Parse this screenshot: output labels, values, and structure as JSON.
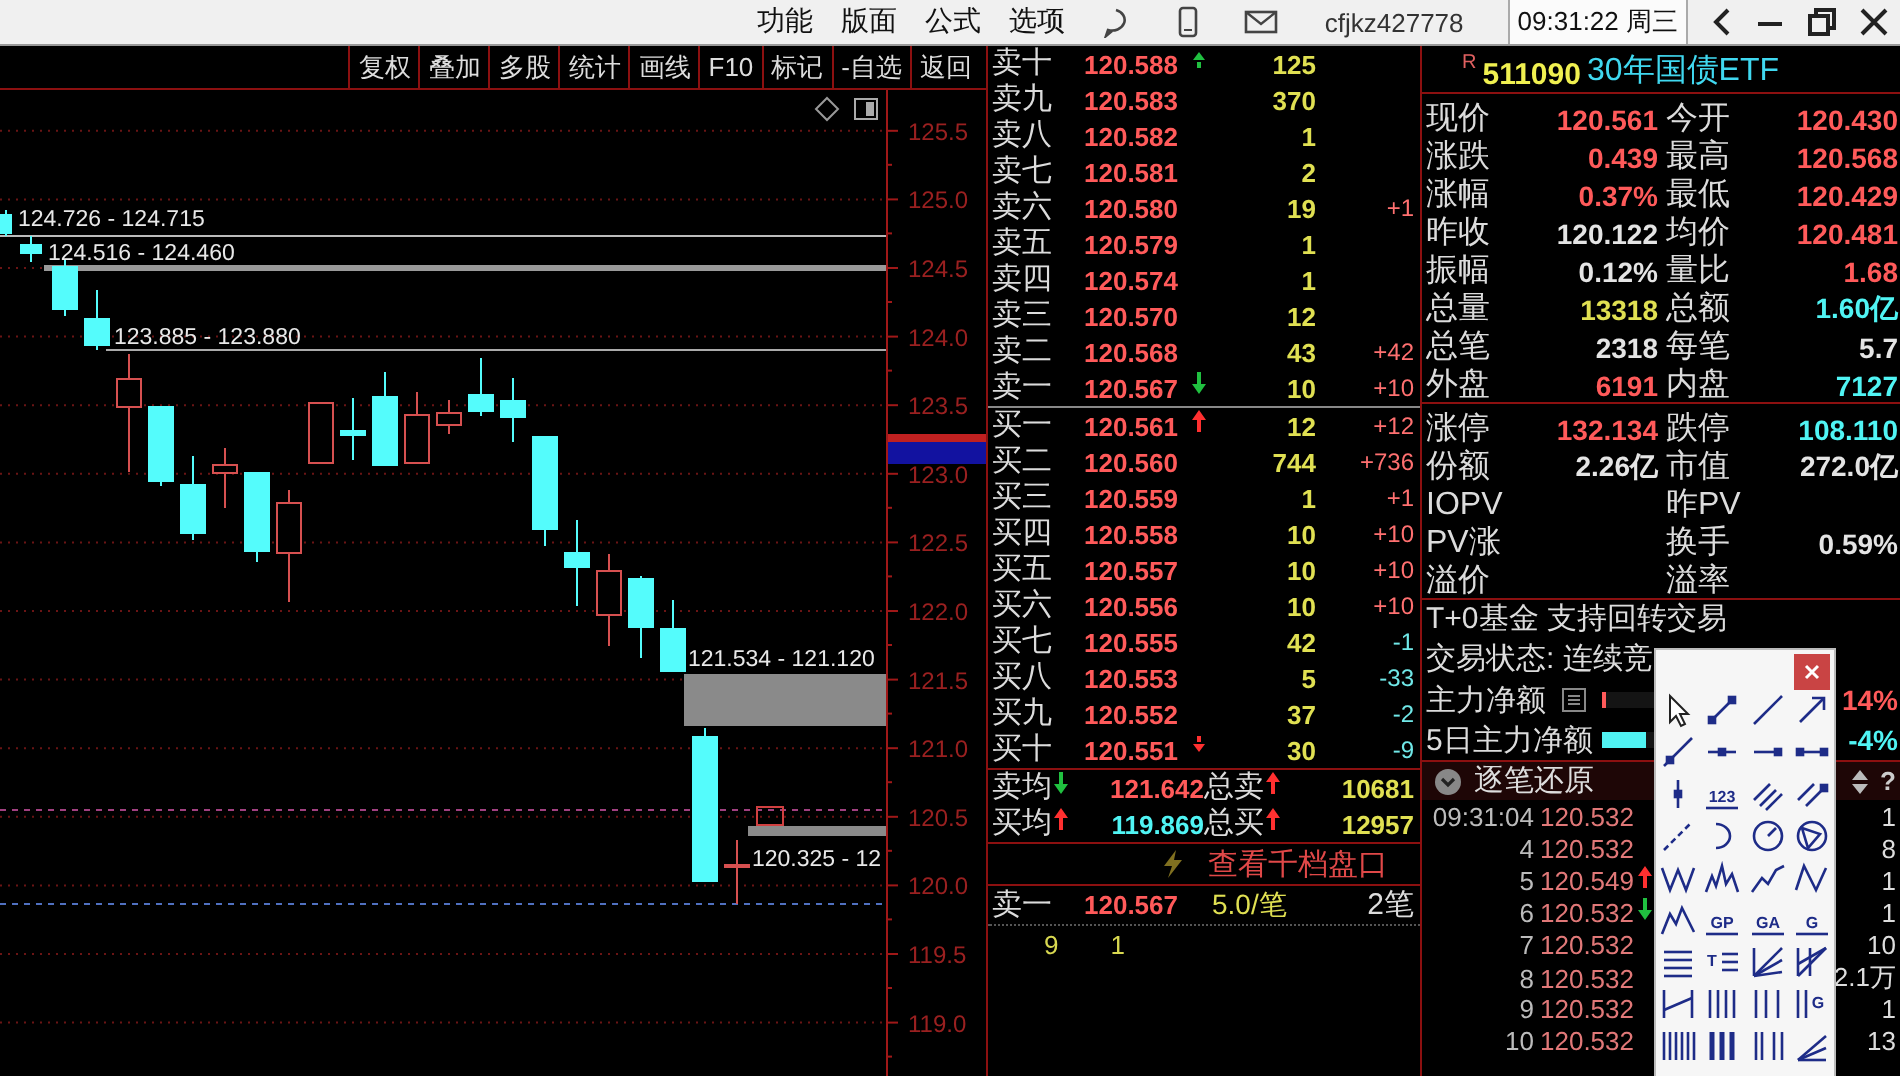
{
  "title_bar": {
    "menu": [
      {
        "label": "功能"
      },
      {
        "label": "版面"
      },
      {
        "label": "公式"
      },
      {
        "label": "选项"
      }
    ],
    "user": "cfjkz427778",
    "clock": "09:31:22 周三"
  },
  "chart": {
    "toolbar": [
      {
        "label": "复权"
      },
      {
        "label": "叠加"
      },
      {
        "label": "多股"
      },
      {
        "label": "统计"
      },
      {
        "label": "画线"
      },
      {
        "label": "F10"
      },
      {
        "label": "标记"
      },
      {
        "label": "-自选"
      },
      {
        "label": "返回"
      }
    ],
    "price_axis": [
      "125.5",
      "125.0",
      "124.5",
      "124.0",
      "123.5",
      "123.0",
      "122.5",
      "122.0",
      "121.5",
      "121.0",
      "120.5",
      "120.0",
      "119.5",
      "119.0"
    ],
    "range_labels": [
      "124.726 - 124.715",
      "124.516 - 124.460",
      "123.885 - 123.880",
      "121.534 - 121.120",
      "120.325 - 12"
    ]
  },
  "order_book": {
    "asks": [
      {
        "label": "卖十",
        "price": "120.588",
        "arrow": {
          "kind": "tick-up"
        },
        "volume": "125"
      },
      {
        "label": "卖九",
        "price": "120.583",
        "volume": "370"
      },
      {
        "label": "卖八",
        "price": "120.582",
        "volume": "1"
      },
      {
        "label": "卖七",
        "price": "120.581",
        "volume": "2"
      },
      {
        "label": "卖六",
        "price": "120.580",
        "volume": "19",
        "change": "+1",
        "color": "#ff7070"
      },
      {
        "label": "卖五",
        "price": "120.579",
        "volume": "1"
      },
      {
        "label": "卖四",
        "price": "120.574",
        "volume": "1"
      },
      {
        "label": "卖三",
        "price": "120.570",
        "volume": "12"
      },
      {
        "label": "卖二",
        "price": "120.568",
        "volume": "43",
        "change": "+42",
        "color": "#ff7070"
      },
      {
        "label": "卖一",
        "price": "120.567",
        "arrow": {
          "kind": "down"
        },
        "volume": "10",
        "change": "+10",
        "color": "#ff7070"
      }
    ],
    "bids": [
      {
        "label": "买一",
        "price": "120.561",
        "arrow": {
          "kind": "up"
        },
        "volume": "12",
        "change": "+12",
        "color": "#ff7070"
      },
      {
        "label": "买二",
        "price": "120.560",
        "volume": "744",
        "change": "+736",
        "color": "#ff7070"
      },
      {
        "label": "买三",
        "price": "120.559",
        "volume": "1",
        "change": "+1",
        "color": "#ff7070"
      },
      {
        "label": "买四",
        "price": "120.558",
        "volume": "10",
        "change": "+10",
        "color": "#ff7070"
      },
      {
        "label": "买五",
        "price": "120.557",
        "volume": "10",
        "change": "+10",
        "color": "#ff7070"
      },
      {
        "label": "买六",
        "price": "120.556",
        "volume": "10",
        "change": "+10",
        "color": "#ff7070"
      },
      {
        "label": "买七",
        "price": "120.555",
        "volume": "42",
        "change": "-1",
        "color": "#70e8e8"
      },
      {
        "label": "买八",
        "price": "120.553",
        "volume": "5",
        "change": "-33",
        "color": "#70e8e8"
      },
      {
        "label": "买九",
        "price": "120.552",
        "volume": "37",
        "change": "-2",
        "color": "#70e8e8"
      },
      {
        "label": "买十",
        "price": "120.551",
        "arrow": {
          "kind": "tick-down"
        },
        "volume": "30",
        "change": "-9",
        "color": "#70e8e8"
      }
    ],
    "totals": [
      {
        "label": "卖均",
        "label_arrow": {
          "kind": "down"
        },
        "price": "121.642",
        "color": "#ff5a5a",
        "total_label": "总卖",
        "total_arrow": {
          "kind": "up"
        },
        "total": "10681"
      },
      {
        "label": "买均",
        "label_arrow": {
          "kind": "up"
        },
        "price": "119.869",
        "color": "#50f4f4",
        "total_label": "总买",
        "total_arrow": {
          "kind": "up"
        },
        "total": "12957"
      }
    ],
    "depth_link": "查看千档盘口",
    "queue": {
      "label": "卖一",
      "price": "120.567",
      "average": "5.0/笔",
      "count": "2笔",
      "orders": [
        "9",
        "1"
      ]
    }
  },
  "quote": {
    "badge": "R",
    "code": "511090",
    "name": "30年国债ETF",
    "stats": [
      [
        {
          "label": "现价",
          "value": "120.561",
          "color": "#ff5a5a"
        },
        {
          "label": "今开",
          "value": "120.430",
          "color": "#ff5a5a"
        }
      ],
      [
        {
          "label": "涨跌",
          "value": "0.439",
          "color": "#ff5a5a"
        },
        {
          "label": "最高",
          "value": "120.568",
          "color": "#ff5a5a"
        }
      ],
      [
        {
          "label": "涨幅",
          "value": "0.37%",
          "color": "#ff5a5a"
        },
        {
          "label": "最低",
          "value": "120.429",
          "color": "#ff5a5a"
        }
      ],
      [
        {
          "label": "昨收",
          "value": "120.122",
          "color": "#e4e4e4"
        },
        {
          "label": "均价",
          "value": "120.481",
          "color": "#ff5a5a"
        }
      ],
      [
        {
          "label": "振幅",
          "value": "0.12%",
          "color": "#e4e4e4"
        },
        {
          "label": "量比",
          "value": "1.68",
          "color": "#ff5a5a"
        }
      ],
      [
        {
          "label": "总量",
          "value": "13318",
          "color": "#e0e052"
        },
        {
          "label": "总额",
          "value": "1.60亿",
          "color": "#50f4f4"
        }
      ],
      [
        {
          "label": "总笔",
          "value": "2318",
          "color": "#e4e4e4"
        },
        {
          "label": "每笔",
          "value": "5.7",
          "color": "#e4e4e4"
        }
      ],
      [
        {
          "label": "外盘",
          "value": "6191",
          "color": "#ff5a5a"
        },
        {
          "label": "内盘",
          "value": "7127",
          "color": "#50f4f4"
        }
      ]
    ],
    "fund_stats": [
      [
        {
          "label": "涨停",
          "value": "132.134",
          "color": "#ff5a5a"
        },
        {
          "label": "跌停",
          "value": "108.110",
          "color": "#50f4f4"
        }
      ],
      [
        {
          "label": "份额",
          "value": "2.26亿",
          "color": "#e4e4e4"
        },
        {
          "label": "市值",
          "value": "272.0亿",
          "color": "#e4e4e4"
        }
      ],
      [
        {
          "label": "IOPV"
        },
        {
          "label": "昨PV"
        }
      ],
      [
        {
          "label": "PV涨"
        },
        {
          "label": "换手",
          "value": "0.59%",
          "color": "#e4e4e4"
        }
      ],
      [
        {
          "label": "溢价"
        },
        {
          "label": "溢率"
        }
      ]
    ],
    "notes": [
      "T+0基金 支持回转交易",
      "交易状态: 连续竞"
    ],
    "flows": [
      {
        "label": "主力净额",
        "has_menu": true,
        "level": 0.08,
        "value": "14%",
        "color": "#ff5a5a"
      },
      {
        "label": "5日主力净额",
        "has_menu": false,
        "level": 0.85,
        "value": "-4%",
        "color": "#50f4f4"
      }
    ]
  },
  "ticks": {
    "title": "逐笔还原",
    "help": "?",
    "rows": [
      {
        "time": "09:31:04",
        "price": "120.532",
        "volume": "1"
      },
      {
        "time": "4",
        "price": "120.532",
        "volume": "8"
      },
      {
        "time": "5",
        "price": "120.549",
        "arrow": {
          "kind": "up"
        },
        "volume": "1"
      },
      {
        "time": "6",
        "price": "120.532",
        "arrow": {
          "kind": "down"
        },
        "volume": "1"
      },
      {
        "time": "7",
        "price": "120.532",
        "volume": "10"
      },
      {
        "time": "8",
        "price": "120.532",
        "volume": "2.1万"
      },
      {
        "time": "9",
        "price": "120.532",
        "volume": "1"
      },
      {
        "time": "10",
        "price": "120.532",
        "volume": "13"
      }
    ]
  },
  "draw_tools": {
    "tools": [
      {
        "kind": "cursor"
      },
      {
        "kind": "segment"
      },
      {
        "kind": "line"
      },
      {
        "kind": "arrow"
      },
      {
        "kind": "ray"
      },
      {
        "kind": "mid-dot"
      },
      {
        "kind": "end-dot"
      },
      {
        "kind": "two-dot"
      },
      {
        "kind": "vertical"
      },
      {
        "kind": "label",
        "label": "123"
      },
      {
        "kind": "parallel"
      },
      {
        "kind": "parallel-dot"
      },
      {
        "kind": "dashed"
      },
      {
        "kind": "arc"
      },
      {
        "kind": "dial"
      },
      {
        "kind": "circle-cross"
      },
      {
        "kind": "w-wave"
      },
      {
        "kind": "mountains"
      },
      {
        "kind": "rising"
      },
      {
        "kind": "n-wave"
      },
      {
        "kind": "peak"
      },
      {
        "kind": "label",
        "label": "GP"
      },
      {
        "kind": "label",
        "label": "GA"
      },
      {
        "kind": "label",
        "label": "G"
      },
      {
        "kind": "list-lines"
      },
      {
        "kind": "text-lines",
        "label": "T"
      },
      {
        "kind": "fan"
      },
      {
        "kind": "fan-cross"
      },
      {
        "kind": "step"
      },
      {
        "kind": "bars"
      },
      {
        "kind": "bars-spaced"
      },
      {
        "kind": "bars-label",
        "label": "G"
      },
      {
        "kind": "bars-dense"
      },
      {
        "kind": "bars-blue"
      },
      {
        "kind": "bars-mixed"
      },
      {
        "kind": "angle"
      }
    ]
  }
}
